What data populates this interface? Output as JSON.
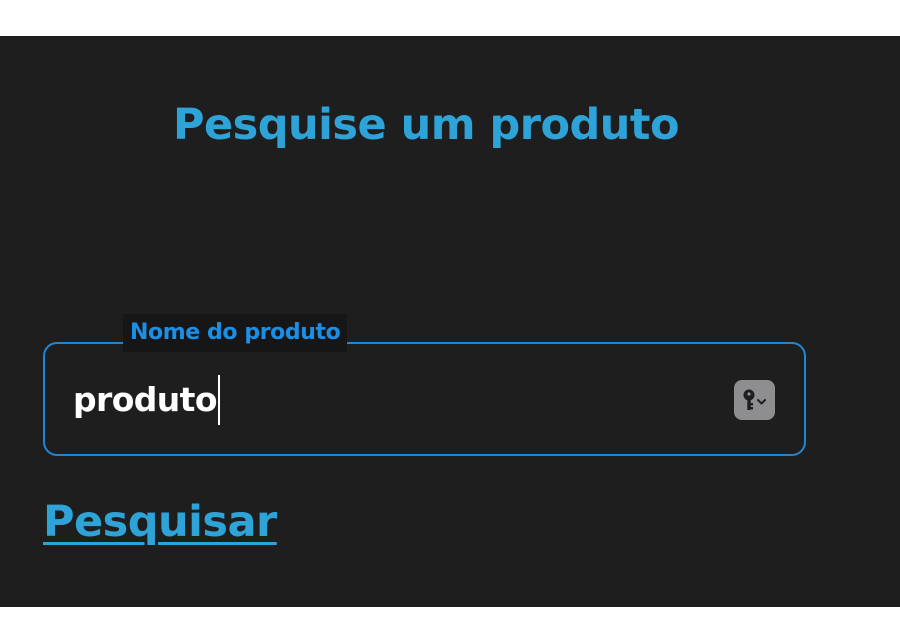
{
  "page": {
    "title": "Pesquise um produto"
  },
  "search_field": {
    "label": "Nome do produto",
    "value": "produto",
    "accent_color": "#1f86d4"
  },
  "password_manager": {
    "icon": "key-icon"
  },
  "actions": {
    "search_link_label": "Pesquisar"
  },
  "colors": {
    "background": "#1e1e1f",
    "heading": "#2ea3d8",
    "input_text": "#ffffff"
  }
}
